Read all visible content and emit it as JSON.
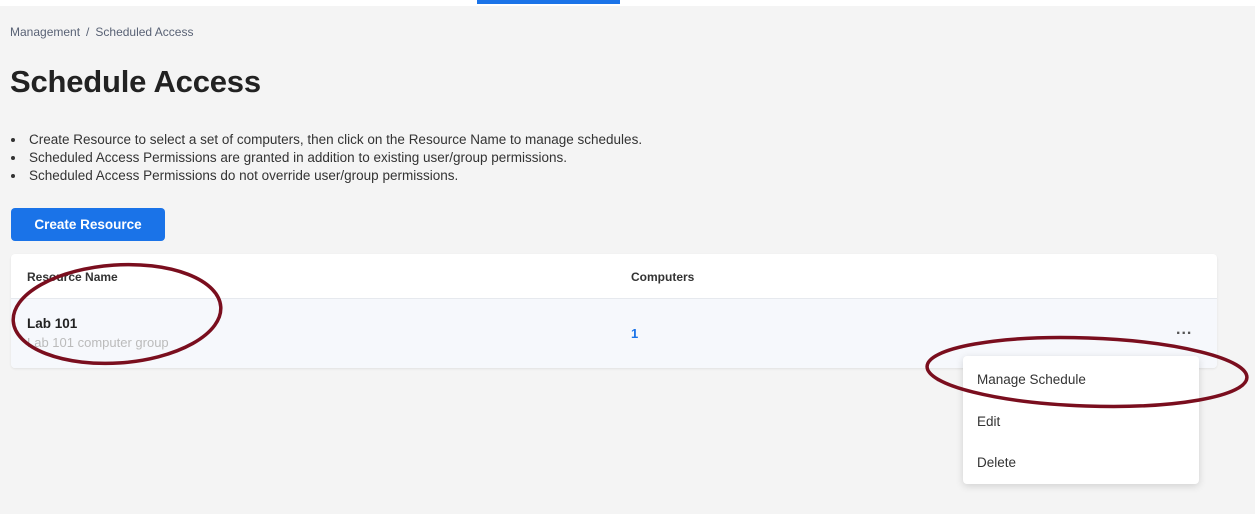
{
  "breadcrumb": {
    "parent": "Management",
    "separator": "/",
    "current": "Scheduled Access"
  },
  "page": {
    "title": "Schedule Access"
  },
  "info": [
    "Create Resource to select a set of computers, then click on the Resource Name to manage schedules.",
    "Scheduled Access Permissions are granted in addition to existing user/group permissions.",
    "Scheduled Access Permissions do not override user/group permissions."
  ],
  "toolbar": {
    "create_label": "Create Resource"
  },
  "table": {
    "columns": [
      "Resource Name",
      "Computers"
    ],
    "rows": [
      {
        "name": "Lab 101",
        "description": "Lab 101 computer group",
        "computers": "1",
        "actions": "..."
      }
    ]
  },
  "menu": {
    "items": [
      "Manage Schedule",
      "Edit",
      "Delete"
    ]
  },
  "colors": {
    "primary": "#1a73e8",
    "annotation": "#7a0e1e",
    "background": "#f4f4f4"
  },
  "icons": {
    "row_actions": "more-horizontal-icon",
    "bullet": "bullet-icon"
  }
}
